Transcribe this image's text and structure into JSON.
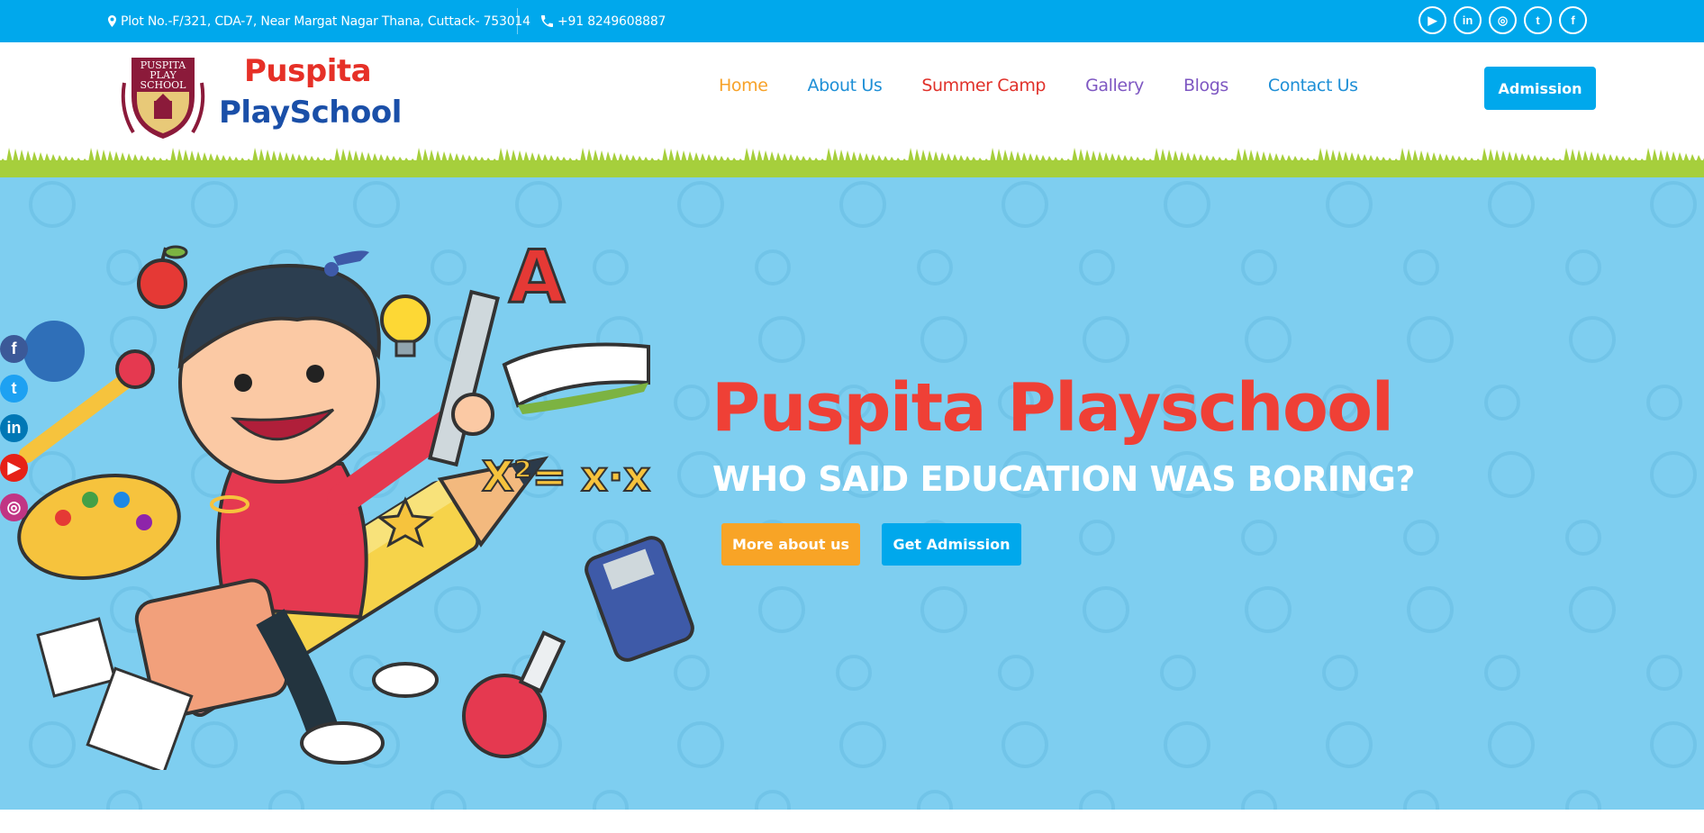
{
  "topbar": {
    "address": "Plot No.-F/321, CDA-7, Near Margat Nagar Thana, Cuttack- 753014",
    "phone": "+91 8249608887",
    "social": [
      {
        "name": "youtube-icon",
        "glyph": "▶"
      },
      {
        "name": "linkedin-icon",
        "glyph": "in"
      },
      {
        "name": "instagram-icon",
        "glyph": "◎"
      },
      {
        "name": "twitter-icon",
        "glyph": "t"
      },
      {
        "name": "facebook-icon",
        "glyph": "f"
      }
    ]
  },
  "header": {
    "logo_badge_text": [
      "PUSPITA",
      "PLAY",
      "SCHOOL"
    ],
    "logo_line1": "Puspita",
    "logo_line2": "PlaySchool",
    "nav": [
      {
        "label": "Home",
        "color": "#f7a229"
      },
      {
        "label": "About Us",
        "color": "#1e8fd6"
      },
      {
        "label": "Summer Camp",
        "color": "#e0312a"
      },
      {
        "label": "Gallery",
        "color": "#7e57c2"
      },
      {
        "label": "Blogs",
        "color": "#7e57c2"
      },
      {
        "label": "Contact Us",
        "color": "#1e8fd6"
      }
    ],
    "admission_label": "Admission"
  },
  "hero": {
    "title": "Puspita Playschool",
    "subtitle": "WHO SAID EDUCATION WAS BORING?",
    "btn_more": "More about us",
    "btn_get": "Get Admission",
    "illustration_text": {
      "letter": "A",
      "equation": "X²= x·x"
    }
  },
  "floating_social": [
    {
      "name": "facebook-icon",
      "glyph": "f",
      "color": "#3b5998"
    },
    {
      "name": "twitter-icon",
      "glyph": "t",
      "color": "#1da1f2"
    },
    {
      "name": "linkedin-icon",
      "glyph": "in",
      "color": "#0077b5"
    },
    {
      "name": "youtube-icon",
      "glyph": "▶",
      "color": "#e62117"
    },
    {
      "name": "instagram-icon",
      "glyph": "◎",
      "color": "#c13584"
    }
  ],
  "colors": {
    "brand_blue": "#00a8ec",
    "hero_bg": "#7ecef0",
    "title_red": "#ef4036",
    "orange": "#f8a426",
    "grass": "#a6cf3c"
  }
}
